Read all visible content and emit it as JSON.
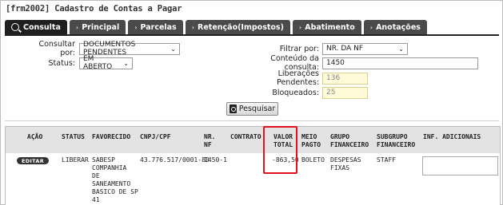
{
  "window": {
    "title": "[frm2002] Cadastro de Contas a Pagar"
  },
  "tabs": [
    {
      "label": "Consulta",
      "icon": "search-icon",
      "active": true
    },
    {
      "label": "Principal",
      "icon": "chevron-right-icon"
    },
    {
      "label": "Parcelas",
      "icon": "chevron-right-icon"
    },
    {
      "label": "Retenção(Impostos)",
      "icon": "chevron-right-icon"
    },
    {
      "label": "Abatimento",
      "icon": "chevron-right-icon"
    },
    {
      "label": "Anotações",
      "icon": "chevron-right-icon"
    }
  ],
  "form": {
    "consultar_por_label": "Consultar por:",
    "consultar_por_value": "DOCUMENTOS PENDENTES",
    "status_label": "Status:",
    "status_value": "EM ABERTO",
    "filtrar_por_label": "Filtrar por:",
    "filtrar_por_value": "NR. DA NF",
    "conteudo_label": "Conteúdo da consulta:",
    "conteudo_value": "1450",
    "liberacoes_label": "Liberações Pendentes:",
    "liberacoes_value": "136",
    "bloqueados_label": "Bloqueados:",
    "bloqueados_value": "25",
    "search_button": "Pesquisar"
  },
  "grid": {
    "headers": {
      "acao": "AÇÃO",
      "status": "STATUS",
      "favorecido": "FAVORECIDO",
      "cnpj": "CNPJ/CPF",
      "nr_nf_1": "NR.",
      "nr_nf_2": "NF",
      "contrato": "CONTRATO",
      "valor_1": "VALOR",
      "valor_2": "TOTAL",
      "meio_1": "MEIO",
      "meio_2": "PAGTO",
      "grupo_1": "GRUPO",
      "grupo_2": "FINANCEIRO",
      "subgrupo_1": "SUBGRUPO",
      "subgrupo_2": "FINANCEIRO",
      "info": "INF. ADICIONAIS"
    },
    "rows": [
      {
        "action": "EDITAR",
        "status": "LIBERAR",
        "favorecido": [
          "SABESP",
          "COMPANHIA",
          "DE",
          "SANEAMENTO",
          "BASICO DE SP",
          "41"
        ],
        "cnpj": "43.776.517/0001-80",
        "nr_nf": "1450-1",
        "contrato": "",
        "valor_total": "-863,50",
        "meio_pagto": "BOLETO",
        "grupo": [
          "DESPESAS",
          "FIXAS"
        ],
        "subgrupo": "STAFF",
        "info": ""
      }
    ]
  },
  "colors": {
    "highlight": "#e0121b",
    "tab_bg": "#4a4a4a",
    "header_bg": "#e3e3e3",
    "readonly_bg": "#fffbd9"
  }
}
